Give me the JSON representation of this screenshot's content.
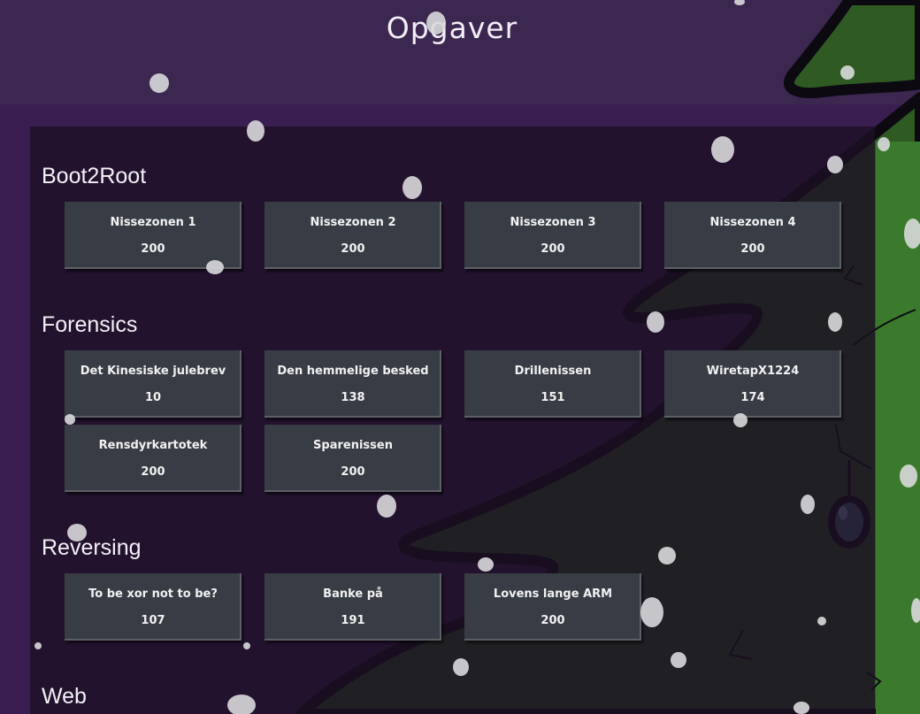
{
  "page": {
    "title": "Opgaver"
  },
  "colors": {
    "background_purple": "#3a1e52",
    "header_purple": "#3b2750",
    "panel": "#1c1024",
    "card": "#383d45",
    "tree_green": "#2f5a24",
    "tree_outline": "#0c0a10",
    "text": "#f1f1f1"
  },
  "categories": [
    {
      "name": "Boot2Root",
      "challenges": [
        {
          "name": "Nissezonen 1",
          "points": "200"
        },
        {
          "name": "Nissezonen 2",
          "points": "200"
        },
        {
          "name": "Nissezonen 3",
          "points": "200"
        },
        {
          "name": "Nissezonen 4",
          "points": "200"
        }
      ]
    },
    {
      "name": "Forensics",
      "challenges": [
        {
          "name": "Det Kinesiske julebrev",
          "points": "10"
        },
        {
          "name": "Den hemmelige besked",
          "points": "138"
        },
        {
          "name": "Drillenissen",
          "points": "151"
        },
        {
          "name": "WiretapX1224",
          "points": "174"
        },
        {
          "name": "Rensdyrkartotek",
          "points": "200"
        },
        {
          "name": "Sparenissen",
          "points": "200"
        }
      ]
    },
    {
      "name": "Reversing",
      "challenges": [
        {
          "name": "To be xor not to be?",
          "points": "107"
        },
        {
          "name": "Banke på",
          "points": "191"
        },
        {
          "name": "Lovens lange ARM",
          "points": "200"
        }
      ]
    },
    {
      "name": "Web",
      "challenges": []
    }
  ]
}
